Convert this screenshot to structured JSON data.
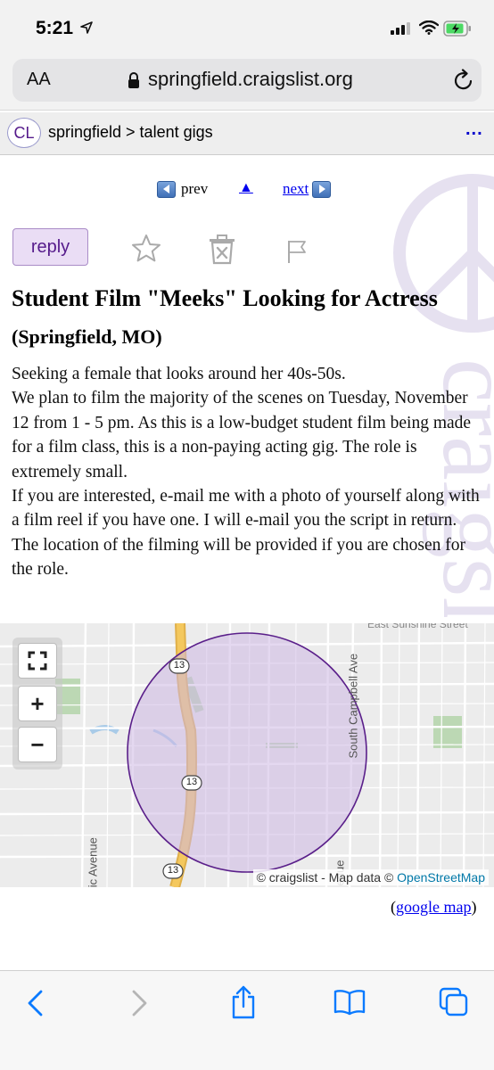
{
  "status_bar": {
    "time": "5:21"
  },
  "browser": {
    "text_size_label": "AA",
    "url": "springfield.craigslist.org"
  },
  "site_header": {
    "logo": "CL",
    "breadcrumb": "springfield > talent gigs",
    "more": "..."
  },
  "nav": {
    "prev": "prev",
    "up": "▲",
    "next": "next"
  },
  "actions": {
    "reply": "reply"
  },
  "post": {
    "title_main": "Student Film \"Meeks\" Looking for Actress",
    "title_location": "(Springfield, MO)",
    "body": [
      "Seeking a female that looks around her 40s-50s.",
      "We plan to film the majority of the scenes on Tuesday, November 12 from 1 - 5 pm. As this is a low-budget student film being made for a film class, this is a non-paying acting gig. The role is extremely small.",
      "If you are interested, e-mail me with a photo of yourself along with a film reel if you have one. I will e-mail you the script in return.",
      "The location of the filming will be provided if you are chosen for the role."
    ]
  },
  "map": {
    "zoom_in": "+",
    "zoom_out": "−",
    "street_labels": [
      "South Campbell Ave",
      "nic Avenue",
      "East Sunshine Street",
      "enue"
    ],
    "route_shields": [
      "13",
      "13",
      "13"
    ],
    "attribution_prefix": "© craigslist - Map data ©",
    "attribution_link": "OpenStreetMap",
    "google_map_link": "google map"
  },
  "colors": {
    "link": "#0000ee",
    "craigslist_purple": "#551a8b",
    "circle_fill": "#cdb8e3",
    "ios_blue": "#0a7aff"
  }
}
